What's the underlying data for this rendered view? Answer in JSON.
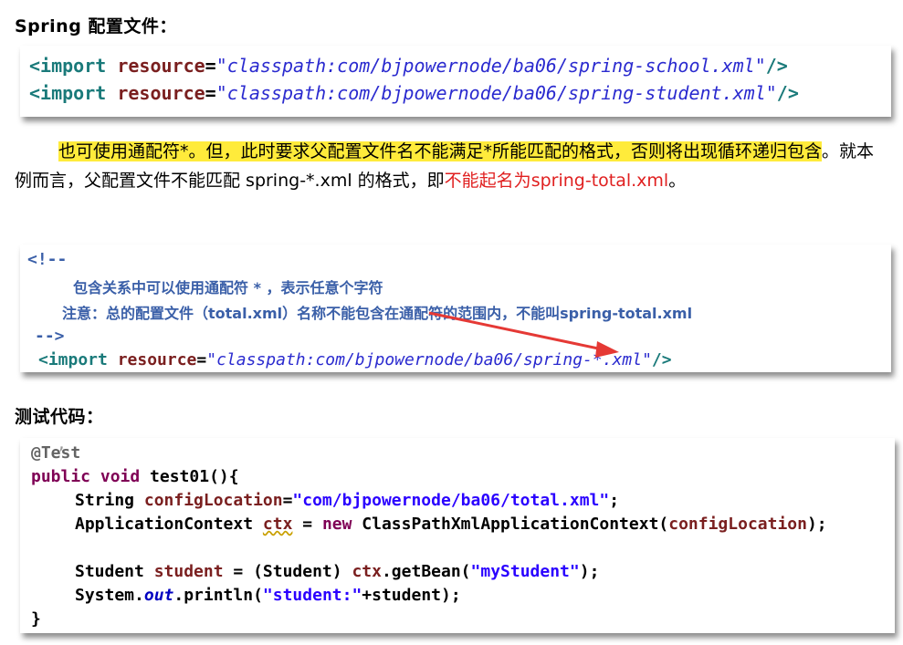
{
  "heading1": "Spring 配置文件：",
  "box1": {
    "lines": [
      {
        "open": "<import ",
        "attr": "resource",
        "eq": "=",
        "value": "\"classpath:com/bjpowernode/ba06/spring-school.xml\"",
        "close": "/>"
      },
      {
        "open": "<import ",
        "attr": "resource",
        "eq": "=",
        "value": "\"classpath:com/bjpowernode/ba06/spring-student.xml\"",
        "close": "/>"
      }
    ]
  },
  "paragraph": {
    "hl1": "也可使用通配符*。但，此时要求父配置文件名不能满足*所能匹配的格式，否则将出现",
    "hl2": "循环递归包含",
    "mid": "。就本例而言，父配置文件不能匹配 spring-*.xml 的格式，即",
    "red1": "不能起名为",
    "red2": "spring-total.xml",
    "end": "。"
  },
  "box2": {
    "comment_open": "<!--",
    "comment_line1": "包含关系中可以使用通配符 * ，表示任意个字符",
    "comment_line2": "注意：总的配置文件（total.xml）名称不能包含在通配符的范围内，不能叫spring-total.xml",
    "comment_close": "-->",
    "import": {
      "open": "<import ",
      "attr": "resource",
      "eq": "=",
      "value": "\"classpath:com/bjpowernode/ba06/spring-*.xml\"",
      "close": "/>"
    },
    "arrow_color": "#e53935"
  },
  "heading2": "测试代码：",
  "code": {
    "annotation": "@Test",
    "sig_kw": "public void ",
    "sig_name": "test01(){",
    "l3_type": "String ",
    "l3_var": "configLocation",
    "l3_eq": "=",
    "l3_str": "\"com/bjpowernode/ba06/total.xml\"",
    "l3_end": ";",
    "l4_type": "ApplicationContext ",
    "l4_var": "ctx",
    "l4_eq": " = ",
    "l4_new": "new ",
    "l4_cls": "ClassPathXmlApplicationContext(",
    "l4_arg": "configLocation",
    "l4_end": ");",
    "l6_type": "Student ",
    "l6_var": "student",
    "l6_eq": " = (Student) ",
    "l6_ctx": "ctx",
    "l6_call": ".getBean(",
    "l6_str": "\"myStudent\"",
    "l6_end": ");",
    "l7_sys": "System.",
    "l7_out": "out",
    "l7_call": ".println(",
    "l7_str": "\"student:\"",
    "l7_end": "+student);",
    "close": "}"
  }
}
